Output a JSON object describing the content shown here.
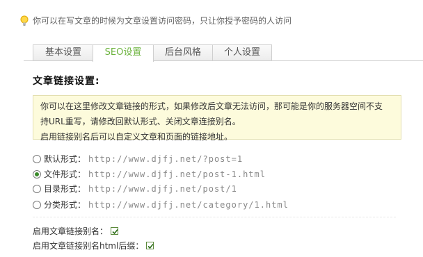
{
  "tip": {
    "icon": "lightbulb-icon",
    "text": "你可以在写文章的时候为文章设置访问密码，只让你授予密码的人访问"
  },
  "tabs": [
    {
      "label": "基本设置",
      "active": false
    },
    {
      "label": "SEO设置",
      "active": true
    },
    {
      "label": "后台风格",
      "active": false
    },
    {
      "label": "个人设置",
      "active": false
    }
  ],
  "section": {
    "title": "文章链接设置:"
  },
  "notice": {
    "line1": "你可以在这里修改文章链接的形式，如果修改后文章无法访问，那可能是你的服务器空间不支",
    "line2": "持URL重写，请修改回默认形式、关闭文章连接别名。",
    "line3": "启用链接别名后可以自定义文章和页面的链接地址。"
  },
  "link_forms": [
    {
      "label": "默认形式：",
      "url": "http://www.djfj.net/?post=1",
      "selected": false
    },
    {
      "label": "文件形式：",
      "url": "http://www.djfj.net/post-1.html",
      "selected": true
    },
    {
      "label": "目录形式：",
      "url": "http://www.djfj.net/post/1",
      "selected": false
    },
    {
      "label": "分类形式：",
      "url": "http://www.djfj.net/category/1.html",
      "selected": false
    }
  ],
  "options": {
    "alias_label": "启用文章链接别名：",
    "alias_checked": true,
    "alias_html_label": "启用文章链接别名html后缀：",
    "alias_html_checked": true
  },
  "colors": {
    "accent": "#6cb33e",
    "notice_bg": "#fdfbdc"
  }
}
